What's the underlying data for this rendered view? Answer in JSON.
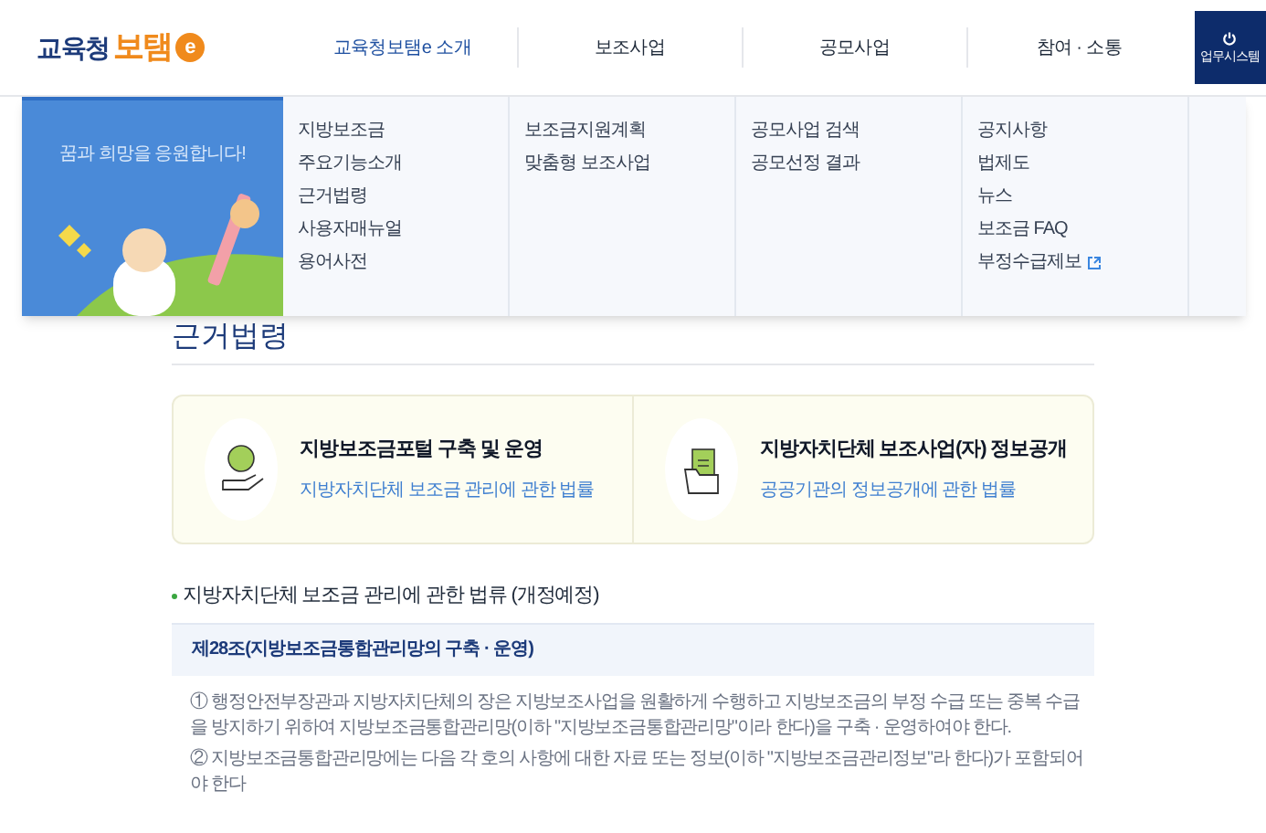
{
  "logo": {
    "text_1": "교육청",
    "text_2": "보탬",
    "badge": "e"
  },
  "nav": [
    {
      "label": "교육청보탬e 소개",
      "selected": true
    },
    {
      "label": "보조사업",
      "selected": false
    },
    {
      "label": "공모사업",
      "selected": false
    },
    {
      "label": "참여 · 소통",
      "selected": false
    }
  ],
  "system_button": {
    "label": "업무시스템"
  },
  "banner": {
    "text": "꿈과 희망을 응원합니다!"
  },
  "menu_columns": [
    {
      "items": [
        {
          "label": "지방보조금",
          "external": false
        },
        {
          "label": "주요기능소개",
          "external": false
        },
        {
          "label": "근거법령",
          "external": false
        },
        {
          "label": "사용자매뉴얼",
          "external": false
        },
        {
          "label": "용어사전",
          "external": false
        }
      ]
    },
    {
      "items": [
        {
          "label": "보조금지원계획",
          "external": false
        },
        {
          "label": "맞춤형 보조사업",
          "external": false
        }
      ]
    },
    {
      "items": [
        {
          "label": "공모사업 검색",
          "external": false
        },
        {
          "label": "공모선정 결과",
          "external": false
        }
      ]
    },
    {
      "items": [
        {
          "label": "공지사항",
          "external": false
        },
        {
          "label": "법제도",
          "external": false
        },
        {
          "label": "뉴스",
          "external": false
        },
        {
          "label": "보조금 FAQ",
          "external": false
        },
        {
          "label": "부정수급제보",
          "external": true
        }
      ]
    }
  ],
  "page_title": "근거법령",
  "law_cards": [
    {
      "kind": "coin",
      "title": "지방보조금포털 구축 및 운영",
      "subtitle": "지방자치단체 보조금 관리에 관한 법률"
    },
    {
      "kind": "folder",
      "title": "지방자치단체 보조사업(자) 정보공개",
      "subtitle": "공공기관의 정보공개에 관한 법률"
    }
  ],
  "section_heading": "지방자치단체 보조금 관리에 관한 법류 (개정예정)",
  "article_title": "제28조(지방보조금통합관리망의 구축 · 운영)",
  "paragraphs": [
    "① 행정안전부장관과 지방자치단체의 장은 지방보조사업을 원활하게 수행하고 지방보조금의 부정 수급 또는 중복 수급을 방지하기 위하여 지방보조금통합관리망(이하 \"지방보조금통합관리망\"이라 한다)을 구축 · 운영하여야 한다.",
    "② 지방보조금통합관리망에는 다음 각 호의 사항에 대한 자료 또는 정보(이하 \"지방보조금관리정보\"라 한다)가 포함되어야 한다"
  ]
}
